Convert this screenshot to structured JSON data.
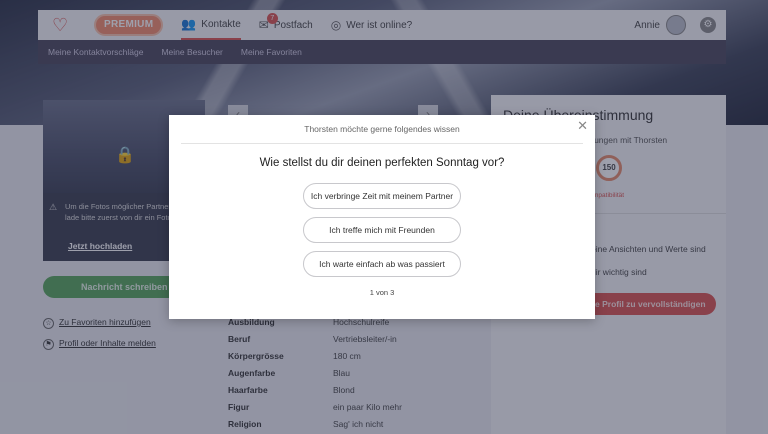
{
  "header": {
    "premium_label": "PREMIUM",
    "nav": {
      "kontakte": "Kontakte",
      "postfach": "Postfach",
      "postfach_badge": "7",
      "online": "Wer ist online?"
    },
    "user_name": "Annie"
  },
  "subnav": {
    "items": [
      "Meine Kontaktvorschläge",
      "Meine Besucher",
      "Meine Favoriten"
    ]
  },
  "profile": {
    "photo_note": "Um die Fotos möglicher Partner sehen, lade bitte zuerst von dir ein Foto hoch.",
    "upload_link": "Jetzt hochladen",
    "message_button": "Nachricht schreiben",
    "favorite_link": "Zu Favoriten hinzufügen",
    "report_link": "Profil oder Inhalte melden",
    "facts": [
      {
        "key": "Ausbildung",
        "value": "Hochschulreife"
      },
      {
        "key": "Beruf",
        "value": "Vertriebsleiter/-in"
      },
      {
        "key": "Körpergrösse",
        "value": "180 cm"
      },
      {
        "key": "Augenfarbe",
        "value": "Blau"
      },
      {
        "key": "Haarfarbe",
        "value": "Blond"
      },
      {
        "key": "Figur",
        "value": "ein paar Kilo mehr"
      },
      {
        "key": "Religion",
        "value": "Sag' ich nicht"
      }
    ]
  },
  "match_card": {
    "title": "Deine Übereinstimmung",
    "subtitle": "mungen mit Thorsten",
    "score": "150",
    "compat_label": "mpatibilität",
    "section_heading": "en",
    "text_1": "eine Ansichten und Werte sind",
    "text_2": "dir wichtig sind",
    "button": "e Profil zu vervollständigen"
  },
  "modal": {
    "header": "Thorsten möchte gerne folgendes wissen",
    "question": "Wie stellst du dir deinen perfekten Sonntag vor?",
    "answers": [
      "Ich verbringe Zeit mit meinem Partner",
      "Ich treffe mich mit Freunden",
      "Ich warte einfach ab was passiert"
    ],
    "pager": "1 von 3"
  },
  "colors": {
    "accent_red": "#d9534f",
    "premium_orange": "#f28a6a",
    "message_green": "#57a55a",
    "subnav_purple": "#4a4559"
  }
}
